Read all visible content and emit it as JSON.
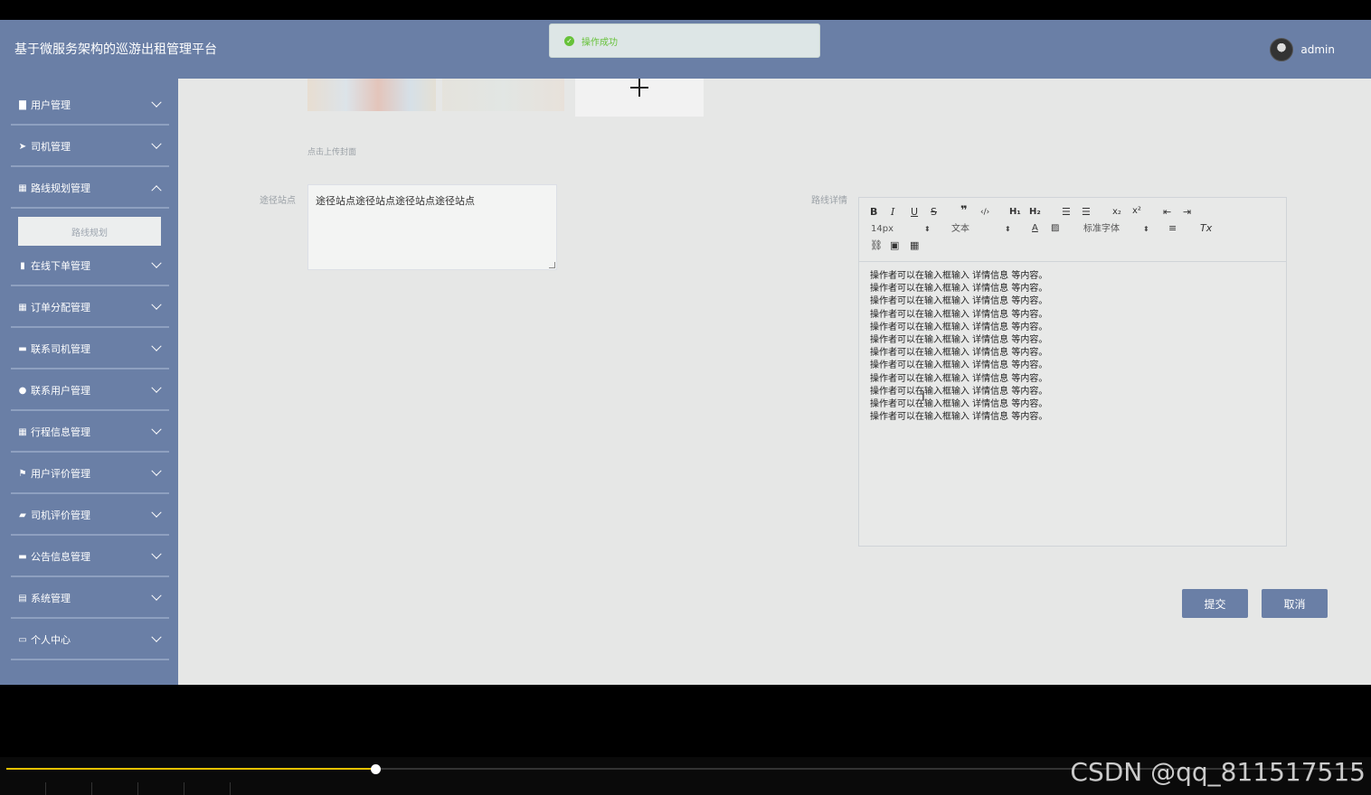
{
  "header": {
    "title": "基于微服务架构的巡游出租管理平台",
    "username": "admin"
  },
  "toast": {
    "message": "操作成功"
  },
  "sidebar": {
    "items": [
      {
        "label": "用户管理",
        "icon": "clipboard-icon",
        "glyph": "▇"
      },
      {
        "label": "司机管理",
        "icon": "paper-plane-icon",
        "glyph": "➤"
      },
      {
        "label": "路线规划管理",
        "icon": "grid-icon",
        "glyph": "▦",
        "expanded": true
      },
      {
        "label": "在线下单管理",
        "icon": "bar-chart-icon",
        "glyph": "▮"
      },
      {
        "label": "订单分配管理",
        "icon": "grid-icon",
        "glyph": "▦"
      },
      {
        "label": "联系司机管理",
        "icon": "monitor-icon",
        "glyph": "▬"
      },
      {
        "label": "联系用户管理",
        "icon": "bulb-icon",
        "glyph": "●"
      },
      {
        "label": "行程信息管理",
        "icon": "grid-icon",
        "glyph": "▦"
      },
      {
        "label": "用户评价管理",
        "icon": "flag-icon",
        "glyph": "⚑"
      },
      {
        "label": "司机评价管理",
        "icon": "thumbs-up-icon",
        "glyph": "▰"
      },
      {
        "label": "公告信息管理",
        "icon": "ticket-icon",
        "glyph": "▬"
      },
      {
        "label": "系统管理",
        "icon": "document-icon",
        "glyph": "▤"
      },
      {
        "label": "个人中心",
        "icon": "window-icon",
        "glyph": "▭"
      }
    ],
    "submenu_label": "路线规划"
  },
  "form": {
    "upload_hint": "点击上传封面",
    "stops_label": "途径站点",
    "stops_value": "途径站点途径站点途径站点途径站点",
    "detail_label": "路线详情",
    "submit_label": "提交",
    "cancel_label": "取消"
  },
  "editor": {
    "font_size": "14px",
    "block_format": "文本",
    "font_family": "标准字体",
    "content_lines": [
      "操作者可以在输入框输入 详情信息 等内容。",
      "操作者可以在输入框输入 详情信息 等内容。",
      "操作者可以在输入框输入 详情信息 等内容。",
      "操作者可以在输入框输入 详情信息 等内容。",
      "操作者可以在输入框输入 详情信息 等内容。",
      "操作者可以在输入框输入 详情信息 等内容。",
      "操作者可以在输入框输入 详情信息 等内容。",
      "操作者可以在输入框输入 详情信息 等内容。",
      "操作者可以在输入框输入 详情信息 等内容。",
      "操作者可以在输入框输入 详情信息 等内容。",
      "操作者可以在输入框输入 详情信息 等内容。",
      "操作者可以在输入框输入 详情信息 等内容。"
    ]
  },
  "player": {
    "progress": 0.272,
    "watermark": "CSDN @qq_811517515"
  },
  "colors": {
    "primary": "#6a7fa6",
    "success": "#67c23a",
    "progress": "#e5c100"
  }
}
